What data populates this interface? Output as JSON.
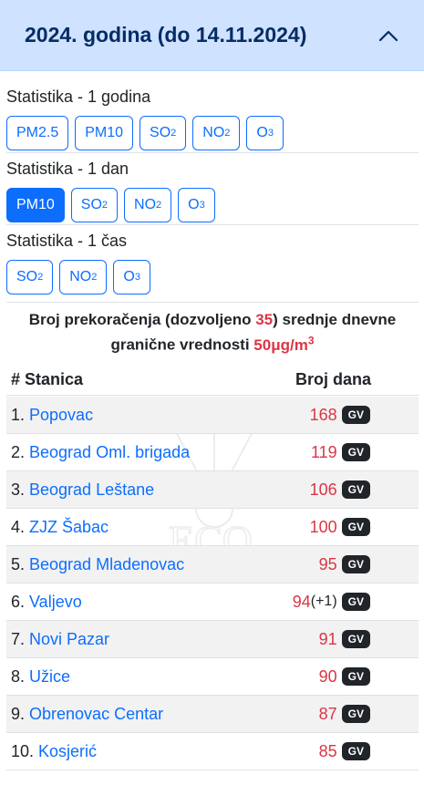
{
  "header": {
    "title": "2024. godina (do 14.11.2024)"
  },
  "stats_year": {
    "label": "Statistika - 1 godina",
    "buttons": [
      {
        "base": "PM2.5",
        "sub": ""
      },
      {
        "base": "PM10",
        "sub": ""
      },
      {
        "base": "SO",
        "sub": "2"
      },
      {
        "base": "NO",
        "sub": "2"
      },
      {
        "base": "O",
        "sub": "3"
      }
    ]
  },
  "stats_day": {
    "label": "Statistika - 1 dan",
    "buttons": [
      {
        "base": "PM10",
        "sub": "",
        "active": true
      },
      {
        "base": "SO",
        "sub": "2"
      },
      {
        "base": "NO",
        "sub": "2"
      },
      {
        "base": "O",
        "sub": "3"
      }
    ]
  },
  "stats_hour": {
    "label": "Statistika - 1 čas",
    "buttons": [
      {
        "base": "SO",
        "sub": "2"
      },
      {
        "base": "NO",
        "sub": "2"
      },
      {
        "base": "O",
        "sub": "3"
      }
    ]
  },
  "summary": {
    "part1": "Broj prekoračenja (dozvoljeno ",
    "allowed": "35",
    "part2": ") srednje dnevne",
    "part3": "granične vrednosti ",
    "limit": "50μg/m",
    "limit_sup": "3"
  },
  "table": {
    "col_station": "# Stanica",
    "col_days": "Broj dana",
    "badge": "GV",
    "rows": [
      {
        "num": "1.",
        "station": "Popovac",
        "days": "168",
        "extra": ""
      },
      {
        "num": "2.",
        "station": "Beograd Oml. brigada",
        "days": "119",
        "extra": ""
      },
      {
        "num": "3.",
        "station": "Beograd Leštane",
        "days": "106",
        "extra": ""
      },
      {
        "num": "4.",
        "station": "ZJZ Šabac",
        "days": "100",
        "extra": ""
      },
      {
        "num": "5.",
        "station": "Beograd Mladenovac",
        "days": "95",
        "extra": ""
      },
      {
        "num": "6.",
        "station": "Valjevo",
        "days": "94",
        "extra": "(+1)"
      },
      {
        "num": "7.",
        "station": "Novi Pazar",
        "days": "91",
        "extra": ""
      },
      {
        "num": "8.",
        "station": "Užice",
        "days": "90",
        "extra": ""
      },
      {
        "num": "9.",
        "station": "Obrenovac Centar",
        "days": "87",
        "extra": ""
      },
      {
        "num": "10.",
        "station": "Kosjerić",
        "days": "85",
        "extra": ""
      }
    ]
  },
  "colors": {
    "primary": "#0d6efd",
    "danger": "#dc3545",
    "header_bg": "#cfe2ff",
    "header_text": "#052c65"
  },
  "icons": {
    "collapse": "chevron-up-icon",
    "watermark": "eco-watermark-icon"
  }
}
